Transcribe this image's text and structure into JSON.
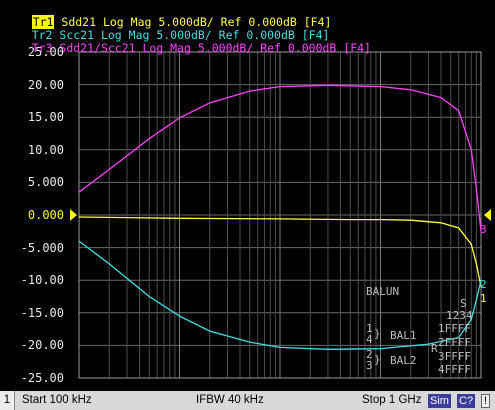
{
  "traces": [
    {
      "id": "Tr1",
      "rest": " Sdd21 Log Mag 5.000dB/ Ref 0.000dB [F4]",
      "color": "#ffff40"
    },
    {
      "id": "Tr2",
      "rest": " Scc21 Log Mag 5.000dB/ Ref 0.000dB [F4]",
      "color": "#40e0e0"
    },
    {
      "id": "Tr3",
      "rest": " Sdd21/Scc21 Log Mag 5.000dB/ Ref 0.000dB [F4]",
      "color": "#ff40ff"
    }
  ],
  "y_axis": {
    "labels": [
      "25.00",
      "20.00",
      "15.00",
      "10.00",
      "5.000",
      "0.000",
      "-5.000",
      "-10.00",
      "-15.00",
      "-20.00",
      "-25.00"
    ],
    "ref_label": "0.000",
    "ref_color": "#ffff00"
  },
  "chart_data": {
    "type": "line",
    "xscale": "log",
    "xlim": [
      100000,
      1000000000
    ],
    "ylim": [
      -25,
      25
    ],
    "grid": true,
    "series": [
      {
        "name": "Sdd21",
        "color": "#ffff40",
        "x": [
          100000,
          1000000,
          10000000,
          50000000,
          100000000,
          200000000,
          400000000,
          600000000,
          800000000,
          900000000,
          1000000000
        ],
        "y": [
          -0.3,
          -0.5,
          -0.6,
          -0.7,
          -0.7,
          -0.8,
          -1.2,
          -2.0,
          -4.5,
          -7.5,
          -11.0
        ]
      },
      {
        "name": "Scc21",
        "color": "#40e0e0",
        "x": [
          100000,
          200000,
          500000,
          1000000,
          2000000,
          5000000,
          10000000,
          30000000,
          100000000,
          300000000,
          600000000,
          800000000,
          900000000,
          1000000000
        ],
        "y": [
          -4.0,
          -7.5,
          -12.5,
          -15.5,
          -17.8,
          -19.5,
          -20.3,
          -20.6,
          -20.5,
          -19.8,
          -18.8,
          -16.0,
          -13.0,
          -10.0
        ]
      },
      {
        "name": "Sdd21/Scc21",
        "color": "#ff40ff",
        "x": [
          100000,
          200000,
          500000,
          1000000,
          2000000,
          5000000,
          10000000,
          30000000,
          100000000,
          200000000,
          400000000,
          600000000,
          800000000,
          900000000,
          1000000000
        ],
        "y": [
          3.5,
          7.0,
          11.7,
          14.9,
          17.2,
          19.0,
          19.7,
          19.9,
          19.7,
          19.2,
          18.0,
          16.0,
          10.0,
          4.0,
          -2.5
        ]
      }
    ],
    "end_labels": [
      "1",
      "2",
      "3"
    ]
  },
  "balun": {
    "header": "BALUN",
    "ports": "1234",
    "s_label": "S",
    "r_label": "R",
    "bal1": "BAL1",
    "bal2": "BAL2",
    "bal1_ports": [
      "1",
      "4"
    ],
    "bal2_ports": [
      "2",
      "3"
    ],
    "rows": [
      "1FFFF",
      "2FFFF",
      "3FFFF",
      "4FFFF"
    ]
  },
  "status": {
    "channel": "1",
    "start": "Start 100 kHz",
    "ifbw": "IFBW 40 kHz",
    "stop": "Stop 1 GHz",
    "mode": "Sim",
    "cal": "C?",
    "extra": "!"
  }
}
